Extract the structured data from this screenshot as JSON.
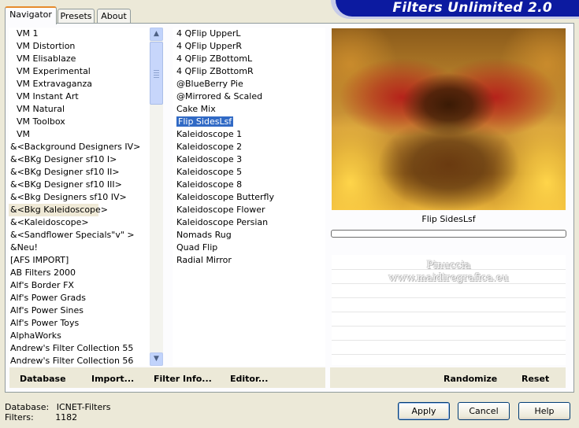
{
  "app": {
    "title": "Filters Unlimited 2.0"
  },
  "tabs": [
    {
      "label": "Navigator"
    },
    {
      "label": "Presets"
    },
    {
      "label": "About"
    }
  ],
  "categories": [
    "VM 1",
    "VM Distortion",
    "VM Elisablaze",
    "VM Experimental",
    "VM Extravaganza",
    "VM Instant Art",
    "VM Natural",
    "VM Toolbox",
    "VM",
    "&<Background Designers IV>",
    "&<BKg Designer sf10 I>",
    "&<BKg Designer sf10 II>",
    "&<BKg Designer sf10 III>",
    "&<Bkg Designers sf10 IV>",
    "&<Bkg Kaleidoscope>",
    "&<Kaleidoscope>",
    "&<Sandflower Specials\"v\" >",
    "&Neu!",
    "[AFS IMPORT]",
    "AB Filters 2000",
    "Alf's Border FX",
    "Alf's Power Grads",
    "Alf's Power Sines",
    "Alf's Power Toys",
    "AlphaWorks",
    "Andrew's Filter Collection 55",
    "Andrew's Filter Collection 56"
  ],
  "selected_category": "&<Bkg Kaleidoscope>",
  "filters": [
    "4 QFlip UpperL",
    "4 QFlip UpperR",
    "4 QFlip ZBottomL",
    "4 QFlip ZBottomR",
    "@BlueBerry Pie",
    "@Mirrored & Scaled",
    "Cake Mix",
    "Flip SidesLsf",
    "Kaleidoscope 1",
    "Kaleidoscope 2",
    "Kaleidoscope 3",
    "Kaleidoscope 5",
    "Kaleidoscope 8",
    "Kaleidoscope Butterfly",
    "Kaleidoscope Flower",
    "Kaleidoscope Persian",
    "Nomads Rug",
    "Quad Flip",
    "Radial Mirror"
  ],
  "selected_filter": "Flip SidesLsf",
  "preview": {
    "label": "Flip SidesLsf",
    "progress": 0
  },
  "watermark": {
    "line1": "Pinuccia",
    "line2": "www.maidiregrafica.eu"
  },
  "toolbar_left": {
    "database": "Database",
    "import": "Import...",
    "filter_info": "Filter Info...",
    "editor": "Editor..."
  },
  "toolbar_right": {
    "randomize": "Randomize",
    "reset": "Reset"
  },
  "status": {
    "database_label": "Database:",
    "database_value": "ICNET-Filters",
    "filters_label": "Filters:",
    "filters_value": "1182"
  },
  "buttons": {
    "apply": "Apply",
    "cancel": "Cancel",
    "help": "Help"
  },
  "colors": {
    "banner": "#0c1aa0",
    "selection": "#316ac5",
    "tab_accent": "#e68b2c"
  },
  "icons": {
    "scroll_up": "chevron-up-icon",
    "scroll_down": "chevron-down-icon"
  }
}
